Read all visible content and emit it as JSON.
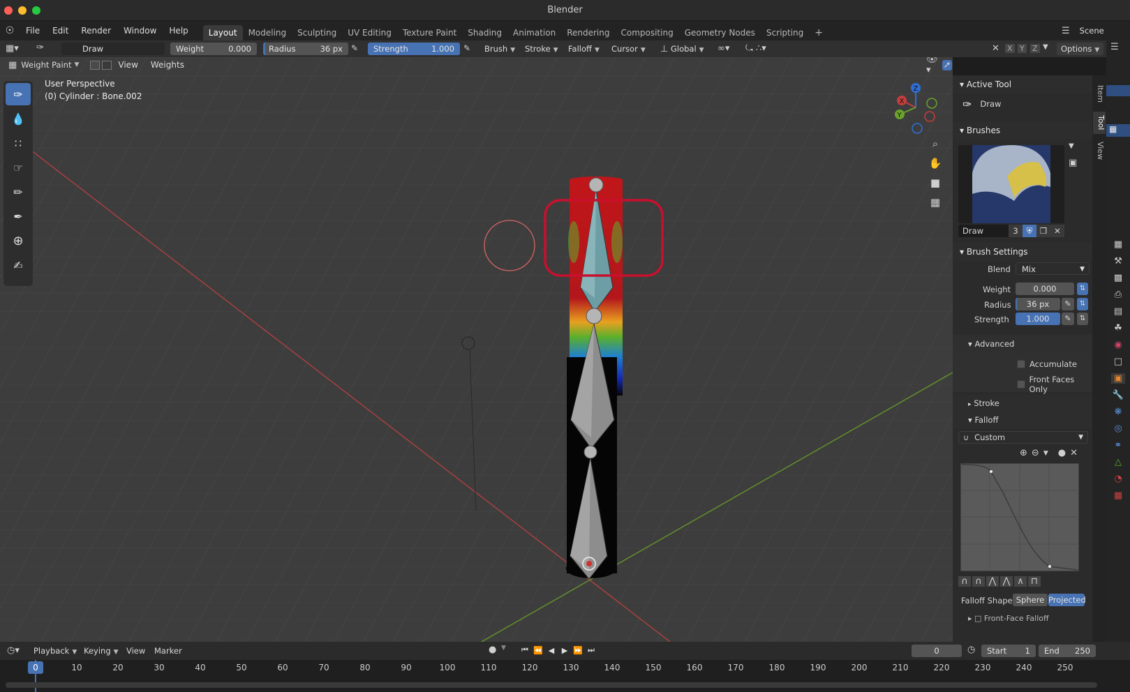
{
  "window": {
    "title": "Blender"
  },
  "menu": {
    "items": [
      "File",
      "Edit",
      "Render",
      "Window",
      "Help"
    ]
  },
  "workspaces": [
    "Layout",
    "Modeling",
    "Sculpting",
    "UV Editing",
    "Texture Paint",
    "Shading",
    "Animation",
    "Rendering",
    "Compositing",
    "Geometry Nodes",
    "Scripting"
  ],
  "scene_label": "Scene",
  "toolheader": {
    "brush_name": "Draw",
    "weight_label": "Weight",
    "weight_value": "0.000",
    "radius_label": "Radius",
    "radius_value": "36 px",
    "strength_label": "Strength",
    "strength_value": "1.000",
    "brush_menu": "Brush",
    "stroke_menu": "Stroke",
    "falloff_menu": "Falloff",
    "cursor_menu": "Cursor",
    "transform_orientation": "Global",
    "options": "Options",
    "axis_x": "X",
    "axis_y": "Y",
    "axis_z": "Z"
  },
  "viewheader": {
    "mode": "Weight Paint",
    "view": "View",
    "weights": "Weights"
  },
  "viewport": {
    "perspective": "User Perspective",
    "object_info": "(0) Cylinder : Bone.002",
    "gizmo": {
      "x": "X",
      "y": "Y",
      "z": "Z"
    }
  },
  "npanel": {
    "tabs": [
      "Item",
      "Tool",
      "View"
    ],
    "active_tool": {
      "title": "Active Tool",
      "tool_name": "Draw"
    },
    "brushes": {
      "title": "Brushes",
      "brush_name": "Draw",
      "users": "3"
    },
    "brush_settings": {
      "title": "Brush Settings",
      "blend_label": "Blend",
      "blend_value": "Mix",
      "weight_label": "Weight",
      "weight_value": "0.000",
      "radius_label": "Radius",
      "radius_value": "36 px",
      "strength_label": "Strength",
      "strength_value": "1.000"
    },
    "advanced": {
      "title": "Advanced",
      "accumulate": "Accumulate",
      "front_faces_only": "Front Faces Only"
    },
    "stroke": {
      "title": "Stroke"
    },
    "falloff": {
      "title": "Falloff",
      "preset": "Custom",
      "shape_label": "Falloff Shape",
      "shape_sphere": "Sphere",
      "shape_projected": "Projected",
      "front_face_partial": "Front-Face Falloff"
    }
  },
  "timeline": {
    "playback": "Playback",
    "keying": "Keying",
    "view": "View",
    "marker": "Marker",
    "current_frame": "0",
    "start_label": "Start",
    "start_value": "1",
    "end_label": "End",
    "end_value": "250",
    "ticks": [
      "0",
      "10",
      "20",
      "30",
      "40",
      "50",
      "60",
      "70",
      "80",
      "90",
      "100",
      "110",
      "120",
      "130",
      "140",
      "150",
      "160",
      "170",
      "180",
      "190",
      "200",
      "210",
      "220",
      "230",
      "240",
      "250"
    ]
  },
  "colors": {
    "accent": "#4772b3",
    "highlight_box": "#c8102e",
    "x_axis": "#b8403f",
    "y_axis": "#6a9a2a"
  }
}
